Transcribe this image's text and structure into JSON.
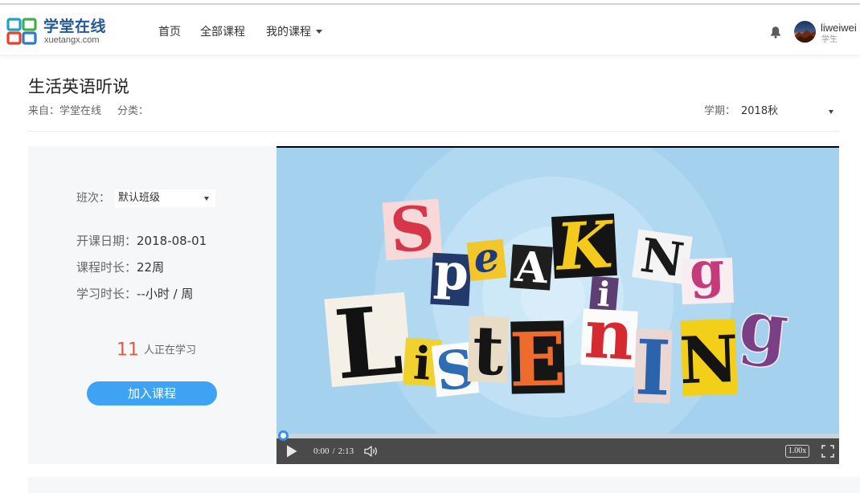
{
  "header": {
    "logo": {
      "name": "学堂在线",
      "domain": "xuetangx.com",
      "colors": [
        "#1fa3c4",
        "#45ad4f",
        "#e5412f",
        "#2d79c7"
      ]
    },
    "nav": [
      {
        "label": "首页"
      },
      {
        "label": "全部课程"
      },
      {
        "label": "我的课程",
        "icon": "caret-down-icon"
      }
    ],
    "notification_icon": "bell-icon",
    "user": {
      "name": "liweiwei",
      "role": "学生"
    }
  },
  "course": {
    "title": "生活英语听说",
    "source_label": "来自：",
    "source": "学堂在线",
    "category_label": "分类：",
    "term_label": "学期：",
    "term": "2018秋",
    "term_icon": "caret-down-icon"
  },
  "enroll": {
    "class_label": "班次：",
    "class_value": "默认班级",
    "start_date_label": "开课日期：",
    "start_date": "2018-08-01",
    "duration_label": "课程时长：",
    "duration": "22周",
    "effort_label": "学习时长：",
    "effort": "--小时 / 周",
    "learners_count": "11",
    "learners_text": "人正在学习",
    "join_button": "加入课程"
  },
  "video": {
    "current_time": "0:00",
    "time_separator": "/",
    "total_time": "2:13",
    "speed": "1.00x",
    "played_fraction": 0,
    "icons": [
      "play-icon",
      "volume-icon",
      "fullscreen-icon"
    ],
    "art": {
      "speaking": [
        {
          "char": "S",
          "fg": "#d6354a",
          "bg": "#f6d9d8"
        },
        {
          "char": "p",
          "fg": "#ffffff",
          "bg": "#23386b"
        },
        {
          "char": "e",
          "fg": "#1f3b7c",
          "bg": "#f3c62b"
        },
        {
          "char": "A",
          "fg": "#ffffff",
          "bg": "#1e1e1e"
        },
        {
          "char": "K",
          "fg": "#f4cb1c",
          "bg": "#141414"
        },
        {
          "char": "i",
          "fg": "#ffffff",
          "bg": "#5e3f73"
        },
        {
          "char": "N",
          "fg": "#1a1a1a",
          "bg": "#f4f4f4"
        },
        {
          "char": "g",
          "fg": "#c43a7b",
          "bg": "#f8eef2"
        }
      ],
      "listening": [
        {
          "char": "L",
          "fg": "#121212",
          "bg": "#f4f0e8"
        },
        {
          "char": "i",
          "fg": "#121212",
          "bg": "#f1d12e"
        },
        {
          "char": "S",
          "fg": "#2e6cb3",
          "bg": "#fbfbfb"
        },
        {
          "char": "t",
          "fg": "#151515",
          "bg": "#e9dcc7"
        },
        {
          "char": "E",
          "fg": "#ef6b2d",
          "bg": "#161616"
        },
        {
          "char": "n",
          "fg": "#d52b30",
          "bg": "#fbfbfb"
        },
        {
          "char": "I",
          "fg": "#2b63ac",
          "bg": "#ead6d2"
        },
        {
          "char": "N",
          "fg": "#141414",
          "bg": "#f4cf19"
        },
        {
          "char": "g",
          "fg": "#7b3f86",
          "bg": "none"
        }
      ]
    }
  },
  "colors": {
    "accent": "#3ea3f4",
    "learners_count": "#e8573d",
    "progress": "#3a8fe0"
  }
}
